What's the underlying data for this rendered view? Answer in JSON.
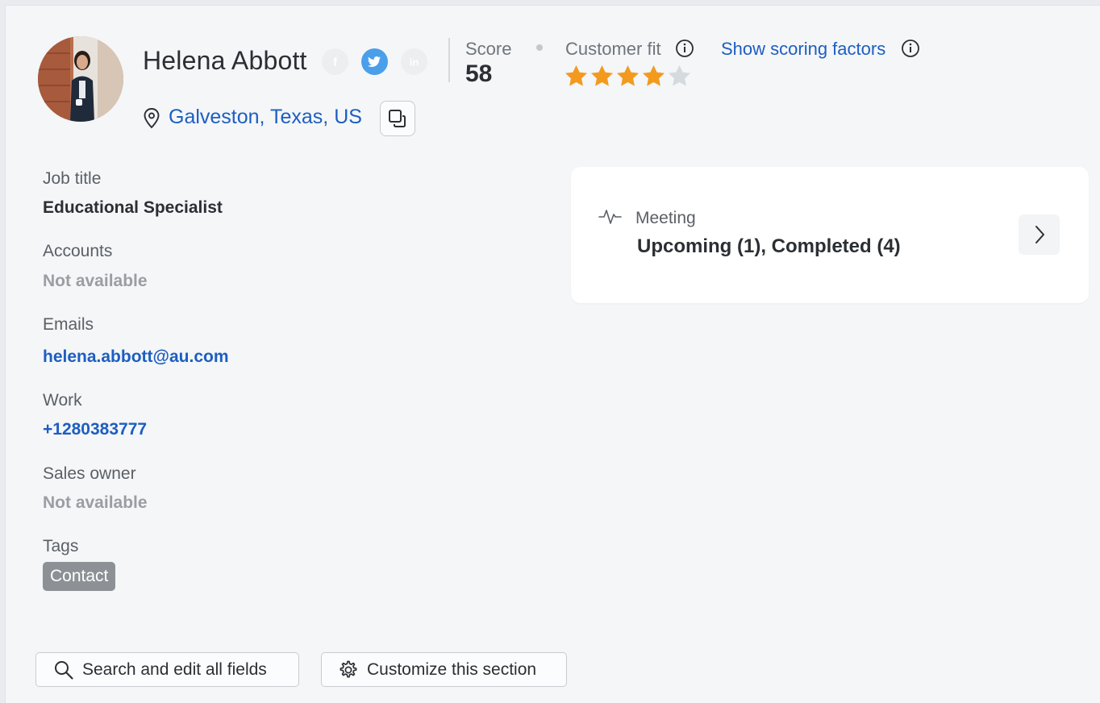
{
  "contact": {
    "name": "Helena Abbott",
    "location": "Galveston, Texas, US"
  },
  "social": {
    "facebook_icon": "facebook-icon",
    "twitter_icon": "twitter-icon",
    "linkedin_icon": "linkedin-icon",
    "twitter_color": "#4a9fea"
  },
  "score": {
    "label": "Score",
    "value": "58"
  },
  "customer_fit": {
    "label": "Customer fit",
    "rating": 4,
    "max_rating": 5,
    "star_color": "#f39a1e"
  },
  "scoring": {
    "link_label": "Show scoring factors"
  },
  "fields": [
    {
      "label": "Job title",
      "value": "Educational Specialist",
      "style": "dark"
    },
    {
      "label": "Accounts",
      "value": "Not available",
      "style": "muted"
    },
    {
      "label": "Emails",
      "value": "helena.abbott@au.com",
      "style": "link"
    },
    {
      "label": "Work",
      "value": "+1280383777",
      "style": "link"
    },
    {
      "label": "Sales owner",
      "value": "Not available",
      "style": "muted"
    }
  ],
  "tags": {
    "label": "Tags",
    "items": [
      "Contact"
    ]
  },
  "activity_card": {
    "label": "Meeting",
    "value": "Upcoming (1), Completed (4)"
  },
  "buttons": {
    "search_edit": "Search and edit all fields",
    "customize": "Customize this section"
  },
  "colors": {
    "link": "#1d5ec0",
    "background": "#f4f6f8"
  }
}
